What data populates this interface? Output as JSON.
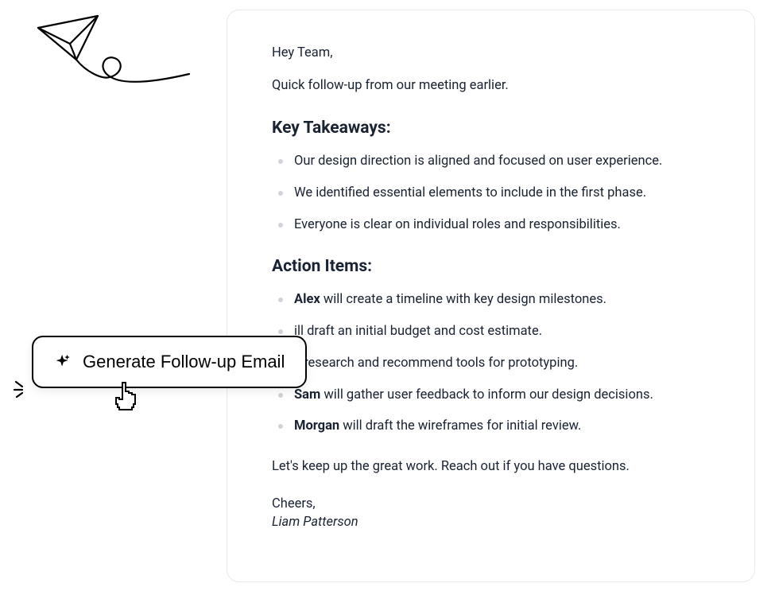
{
  "button": {
    "label": "Generate Follow-up Email"
  },
  "email": {
    "greeting": "Hey Team,",
    "intro": "Quick follow-up from our meeting earlier.",
    "heading_takeaways": "Key Takeaways:",
    "takeaways": [
      "Our design direction is aligned and focused on user experience.",
      "We identified essential elements to include in the first phase.",
      "Everyone is clear on individual roles and responsibilities."
    ],
    "heading_actions": "Action Items:",
    "actions": [
      {
        "name": "Alex",
        "task": " will create a timeline with key design milestones."
      },
      {
        "name": "",
        "prefix": "ill draft an initial budget and cost estimate.",
        "task": ""
      },
      {
        "name": "",
        "prefix": "ll research and recommend tools for prototyping.",
        "task": ""
      },
      {
        "name": "Sam",
        "task": " will gather user feedback to inform our design decisions."
      },
      {
        "name": "Morgan",
        "task": " will draft the wireframes for initial review."
      }
    ],
    "closing": "Let's keep up the great work. Reach out if you have questions.",
    "signoff": "Cheers,",
    "signature": "Liam Patterson"
  }
}
